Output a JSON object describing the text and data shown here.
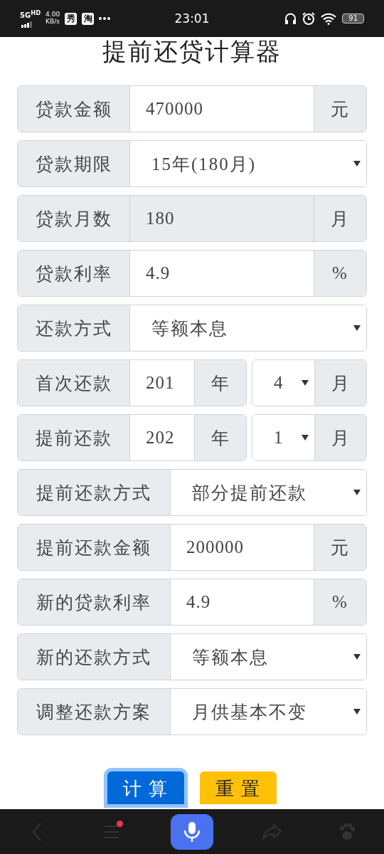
{
  "status_bar": {
    "network": "5G",
    "network_sup": "HD",
    "speed": "4.00",
    "speed_unit": "KB/s",
    "app_badges": [
      "秀",
      "淘"
    ],
    "time": "23:01",
    "battery": "91"
  },
  "title": "提前还贷计算器",
  "sections": [
    {
      "rows": [
        {
          "kind": "input",
          "label": "贷款金额",
          "value": "470000",
          "suffix": "元",
          "disabled": false
        },
        {
          "kind": "select",
          "label": "贷款期限",
          "value": "15年(180月)"
        },
        {
          "kind": "input",
          "label": "贷款月数",
          "value": "180",
          "suffix": "月",
          "disabled": true
        },
        {
          "kind": "input",
          "label": "贷款利率",
          "value": "4.9",
          "suffix": "%",
          "disabled": false
        },
        {
          "kind": "select",
          "label": "还款方式",
          "value": "等额本息"
        },
        {
          "kind": "date",
          "label": "首次还款",
          "year": "201",
          "year_suffix": "年",
          "month": "4",
          "month_suffix": "月"
        },
        {
          "kind": "date",
          "label": "提前还款",
          "year": "202",
          "year_suffix": "年",
          "month": "1",
          "month_suffix": "月"
        }
      ]
    },
    {
      "rows": [
        {
          "kind": "select",
          "label": "提前还款方式",
          "value": "部分提前还款"
        },
        {
          "kind": "input",
          "label": "提前还款金额",
          "value": "200000",
          "suffix": "元",
          "disabled": false
        },
        {
          "kind": "input",
          "label": "新的贷款利率",
          "value": "4.9",
          "suffix": "%",
          "disabled": false
        },
        {
          "kind": "select",
          "label": "新的还款方式",
          "value": "等额本息"
        },
        {
          "kind": "select",
          "label": "调整还款方案",
          "value": "月供基本不变"
        }
      ]
    }
  ],
  "buttons": [
    {
      "kind": "primary",
      "label": "计 算",
      "focused": true
    },
    {
      "kind": "warning",
      "label": "重 置",
      "focused": false
    }
  ],
  "nav": [
    {
      "kind": "back",
      "badge": false
    },
    {
      "kind": "menu",
      "badge": true
    },
    {
      "kind": "mic",
      "badge": false
    },
    {
      "kind": "share",
      "badge": false
    },
    {
      "kind": "paw",
      "badge": false
    }
  ]
}
